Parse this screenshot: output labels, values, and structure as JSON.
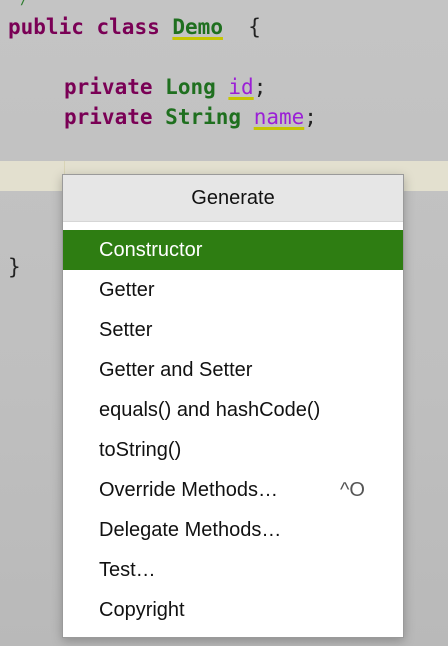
{
  "code": {
    "line1": {
      "keyword1": "public",
      "keyword2": "class",
      "class_name": "Demo",
      "brace": "{"
    },
    "line2": {
      "modifier": "private",
      "type": "Long",
      "identifier": "id",
      "terminator": ";"
    },
    "line3": {
      "modifier": "private",
      "type": "String",
      "identifier": "name",
      "terminator": ";"
    },
    "closing_brace": "}"
  },
  "generate_menu": {
    "title": "Generate",
    "items": [
      {
        "label": "Constructor",
        "shortcut": "",
        "selected": true
      },
      {
        "label": "Getter",
        "shortcut": ""
      },
      {
        "label": "Setter",
        "shortcut": ""
      },
      {
        "label": "Getter and Setter",
        "shortcut": ""
      },
      {
        "label": "equals() and hashCode()",
        "shortcut": ""
      },
      {
        "label": "toString()",
        "shortcut": ""
      },
      {
        "label": "Override Methods…",
        "shortcut": "^O"
      },
      {
        "label": "Delegate Methods…",
        "shortcut": ""
      },
      {
        "label": "Test…",
        "shortcut": ""
      },
      {
        "label": "Copyright",
        "shortcut": ""
      }
    ]
  },
  "colors": {
    "selection": "#2e7d12",
    "keyword": "#7a0055",
    "type": "#1f6f1f",
    "field": "#9b1fd6"
  }
}
